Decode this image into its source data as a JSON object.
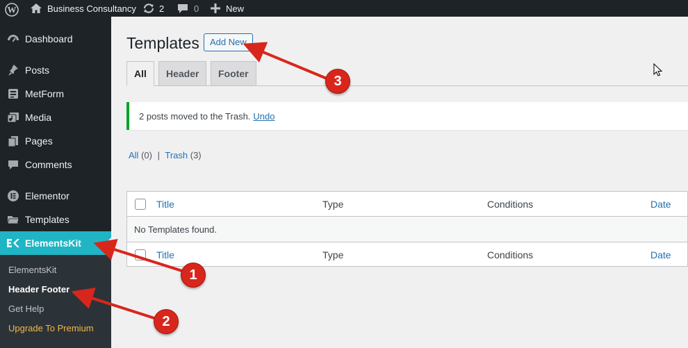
{
  "adminbar": {
    "site_name": "Business Consultancy",
    "updates_count": "2",
    "comments_count": "0",
    "new_label": "New"
  },
  "sidebar": {
    "items": [
      {
        "label": "Dashboard",
        "icon": "dashboard-icon"
      },
      {
        "label": "Posts",
        "icon": "pin-icon"
      },
      {
        "label": "MetForm",
        "icon": "form-icon"
      },
      {
        "label": "Media",
        "icon": "media-icon"
      },
      {
        "label": "Pages",
        "icon": "pages-icon"
      },
      {
        "label": "Comments",
        "icon": "comment-icon"
      },
      {
        "label": "Elementor",
        "icon": "elementor-icon"
      },
      {
        "label": "Templates",
        "icon": "folder-icon"
      },
      {
        "label": "ElementsKit",
        "icon": "elementskit-icon"
      }
    ],
    "submenu": [
      "ElementsKit",
      "Header Footer",
      "Get Help",
      "Upgrade To Premium"
    ]
  },
  "main": {
    "title": "Templates",
    "add_new": "Add New",
    "tabs": [
      "All",
      "Header",
      "Footer"
    ],
    "notice": {
      "text": "2 posts moved to the Trash.",
      "undo": "Undo"
    },
    "filters": {
      "all": "All",
      "all_count": "(0)",
      "sep": "|",
      "trash": "Trash",
      "trash_count": "(3)"
    },
    "table": {
      "columns": [
        "Title",
        "Type",
        "Conditions",
        "Date"
      ],
      "empty_message": "No Templates found."
    }
  },
  "annotations": [
    "1",
    "2",
    "3"
  ],
  "colors": {
    "accent": "#2271b1",
    "elementskit": "#1fb5c4",
    "annotation": "#d9261c",
    "premium": "#f0b849"
  }
}
